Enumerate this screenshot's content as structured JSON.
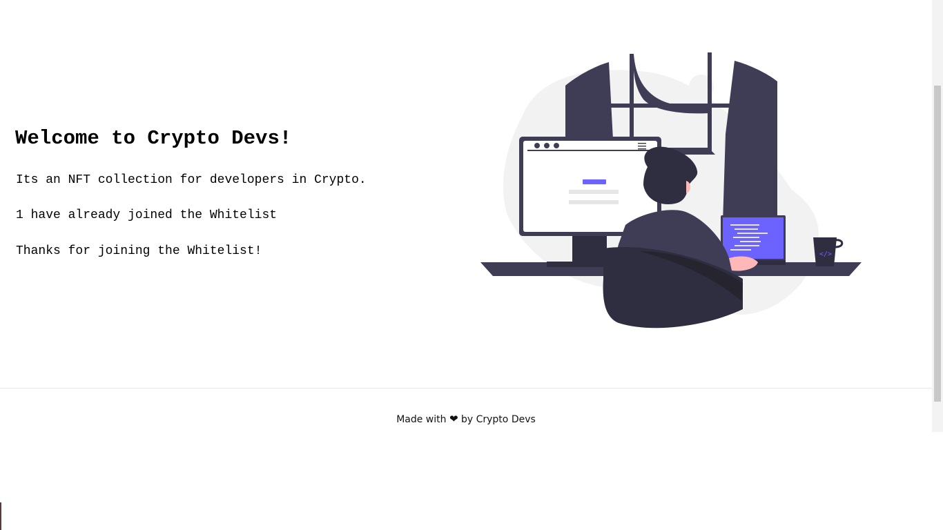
{
  "hero": {
    "title": "Welcome to Crypto Devs!",
    "description": "Its an NFT collection for developers in Crypto.",
    "joined_status": "1 have already joined the Whitelist",
    "thanks_message": "Thanks for joining the Whitelist!"
  },
  "illustration": {
    "icon": "developer-at-desk-illustration",
    "accent_color": "#6c63ff",
    "dark_color": "#3f3d56",
    "mug_glyph": "</>"
  },
  "footer": {
    "prefix": "Made with",
    "heart_glyph": "❤",
    "suffix": "by Crypto Devs"
  }
}
